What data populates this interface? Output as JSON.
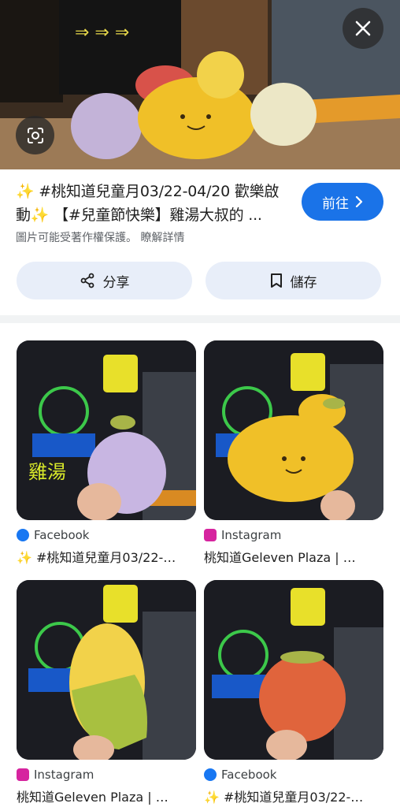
{
  "hero": {
    "alt": "fruit plush toys display"
  },
  "result": {
    "title_line1": "✨ #桃知道兒童月03/22-04/20 歡樂啟",
    "title_line2": "動✨ 【#兒童節快樂】雞湯大叔的 ...",
    "copyright": "圖片可能受著作權保護。 瞭解詳情",
    "visit_label": "前往"
  },
  "actions": {
    "share_label": "分享",
    "save_label": "儲存"
  },
  "grid": [
    {
      "source": "Facebook",
      "source_color": "#1877f2",
      "caption": "✨ #桃知道兒童月03/22-…",
      "plush": "purple"
    },
    {
      "source": "Instagram",
      "source_color": "#d6249f",
      "caption": "桃知道Geleven Plaza | …",
      "plush": "mango"
    },
    {
      "source": "Instagram",
      "source_color": "#d6249f",
      "caption": "桃知道Geleven Plaza | …",
      "plush": "corn"
    },
    {
      "source": "Facebook",
      "source_color": "#1877f2",
      "caption": "✨ #桃知道兒童月03/22-…",
      "plush": "strawberry"
    }
  ],
  "colors": {
    "accent": "#1a73e8",
    "button_bg": "#e8eef9",
    "divider": "#f1f3f4"
  },
  "icons": {
    "lens": "google-lens-icon",
    "close": "close-icon",
    "share": "share-icon",
    "save": "bookmark-icon",
    "chevron": "chevron-right-icon"
  }
}
